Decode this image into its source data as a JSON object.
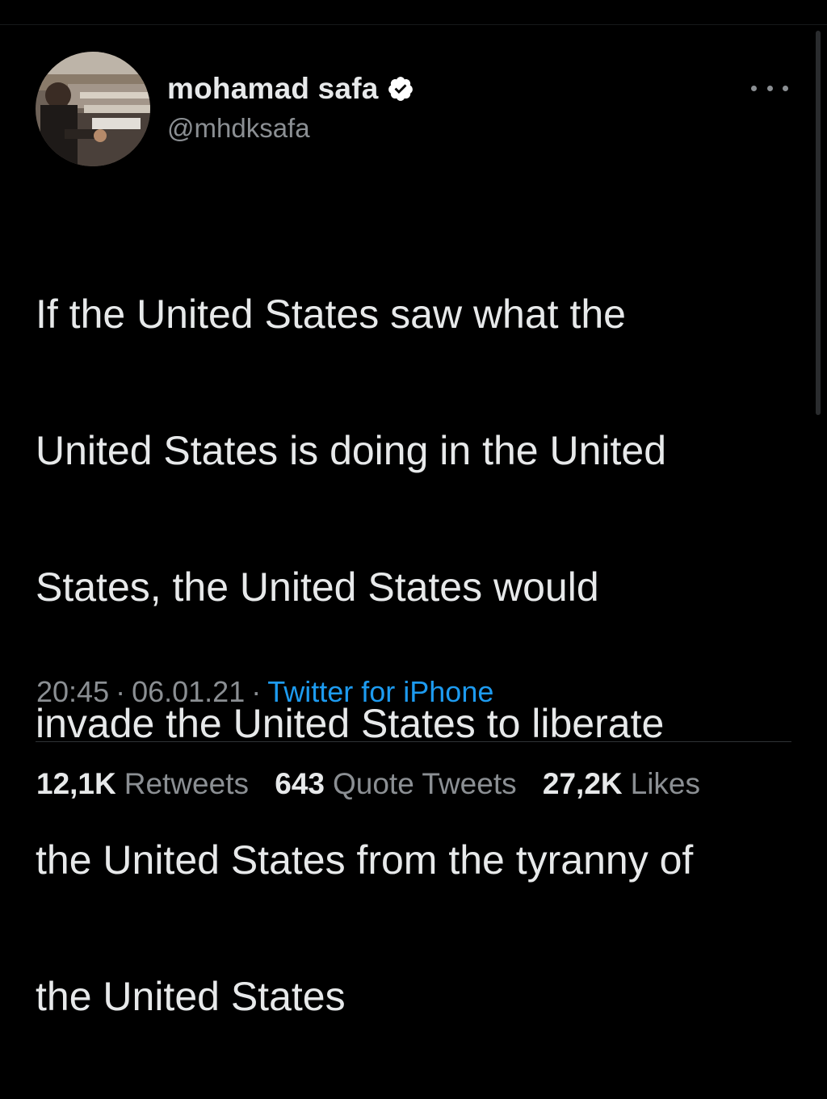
{
  "author": {
    "display_name": "mohamad safa",
    "handle": "@mhdksafa",
    "verified": true
  },
  "tweet": {
    "text_lines": [
      "If the United States saw what the",
      "United States is doing in the United",
      "States, the United States would",
      "invade the United States to liberate",
      "the United States from the tyranny of",
      "the United States"
    ]
  },
  "meta": {
    "time": "20:45",
    "date": "06.01.21",
    "separator": "·",
    "source": "Twitter for iPhone"
  },
  "stats": {
    "retweets_count": "12,1K",
    "retweets_label": "Retweets",
    "quotes_count": "643",
    "quotes_label": "Quote Tweets",
    "likes_count": "27,2K",
    "likes_label": "Likes"
  },
  "icons": {
    "verified": "verified-badge-icon",
    "more": "more-horizontal-icon"
  },
  "colors": {
    "background": "#000000",
    "text_primary": "#e7e9ea",
    "text_secondary": "#8b8f93",
    "link": "#1d9bf0",
    "divider": "#2f3336"
  }
}
